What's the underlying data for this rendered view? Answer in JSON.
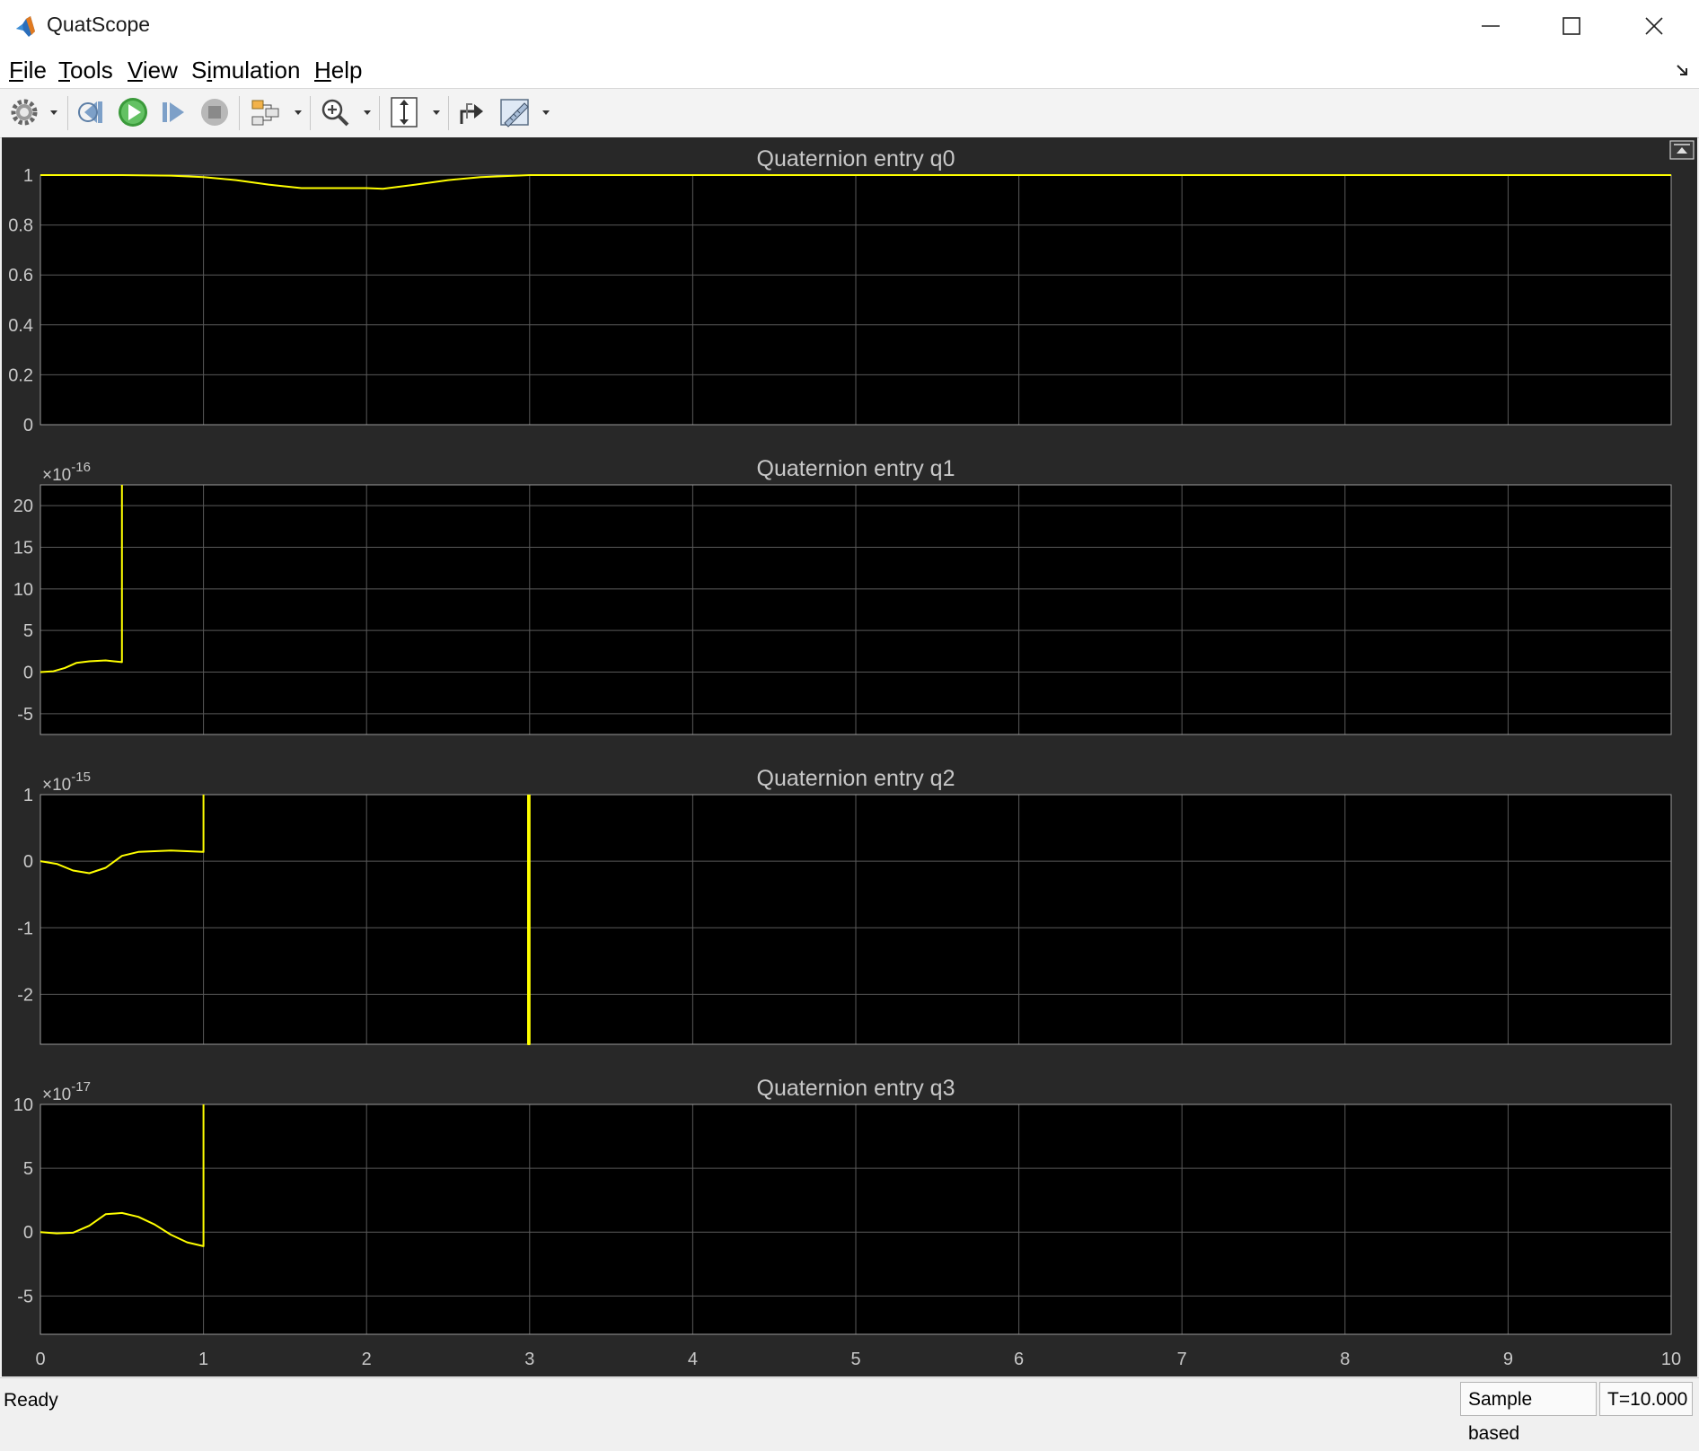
{
  "window": {
    "title": "QuatScope"
  },
  "menu": [
    {
      "pre": "",
      "ul": "F",
      "post": "ile"
    },
    {
      "pre": "",
      "ul": "T",
      "post": "ools"
    },
    {
      "pre": "",
      "ul": "V",
      "post": "iew"
    },
    {
      "pre": "S",
      "ul": "i",
      "post": "mulation"
    },
    {
      "pre": "",
      "ul": "H",
      "post": "elp"
    }
  ],
  "toolbar": {
    "items": [
      "settings-icon",
      "dropdown-arrow-icon",
      "step-back-icon",
      "run-icon",
      "step-forward-icon",
      "stop-icon",
      "highlight-block-icon",
      "dropdown-arrow-icon",
      "zoom-in-icon",
      "dropdown-arrow-icon",
      "autoscale-icon",
      "dropdown-arrow-icon",
      "restore-layout-icon",
      "measurements-icon",
      "dropdown-arrow-icon"
    ]
  },
  "status": {
    "left": "Ready",
    "mode": "Sample based",
    "time": "T=10.000"
  },
  "colors": {
    "plot_bg": "#000000",
    "panel_bg": "#282828",
    "grid": "#5a5a5a",
    "axis_text": "#c8c8c8",
    "line": "#ffff00"
  },
  "chart_data": [
    {
      "type": "line",
      "title": "Quaternion entry q0",
      "exponent_base": "×10",
      "exponent": "",
      "xlim": [
        0,
        10
      ],
      "ylim": [
        0,
        1
      ],
      "xticks": [
        0,
        1,
        2,
        3,
        4,
        5,
        6,
        7,
        8,
        9,
        10
      ],
      "yticks": [
        "1",
        "0.8",
        "0.6",
        "0.4",
        "0.2",
        "0"
      ],
      "ytick_values": [
        1,
        0.8,
        0.6,
        0.4,
        0.2,
        0
      ],
      "grid": true,
      "series": [
        {
          "x": [
            0,
            0.5,
            0.8,
            1.0,
            1.2,
            1.4,
            1.6,
            1.8,
            2.0,
            2.1,
            2.3,
            2.5,
            2.7,
            3.0,
            10
          ],
          "y": [
            1,
            1,
            0.998,
            0.992,
            0.98,
            0.962,
            0.948,
            0.948,
            0.948,
            0.945,
            0.962,
            0.98,
            0.992,
            1,
            1
          ]
        }
      ]
    },
    {
      "type": "line",
      "title": "Quaternion entry q1",
      "exponent_base": "×10",
      "exponent": "-16",
      "xlim": [
        0,
        10
      ],
      "ylim": [
        -7.5,
        22.5
      ],
      "xticks": [
        0,
        1,
        2,
        3,
        4,
        5,
        6,
        7,
        8,
        9,
        10
      ],
      "yticks": [
        "20",
        "15",
        "10",
        "5",
        "0",
        "-5"
      ],
      "ytick_values": [
        20,
        15,
        10,
        5,
        0,
        -5
      ],
      "grid": true,
      "series": [
        {
          "x": [
            0,
            0.08,
            0.15,
            0.22,
            0.3,
            0.4,
            0.5,
            0.5,
            0.5
          ],
          "y": [
            0,
            0.1,
            0.5,
            1.1,
            1.3,
            1.4,
            1.2,
            1.2,
            22.5
          ]
        }
      ]
    },
    {
      "type": "line",
      "title": "Quaternion entry q2",
      "exponent_base": "×10",
      "exponent": "-15",
      "xlim": [
        0,
        10
      ],
      "ylim": [
        -2.75,
        1
      ],
      "xticks": [
        0,
        1,
        2,
        3,
        4,
        5,
        6,
        7,
        8,
        9,
        10
      ],
      "yticks": [
        "1",
        "0",
        "-1",
        "-2"
      ],
      "ytick_values": [
        1,
        0,
        -1,
        -2
      ],
      "grid": true,
      "series": [
        {
          "x": [
            0,
            0.1,
            0.2,
            0.3,
            0.4,
            0.5,
            0.6,
            0.8,
            1.0,
            1.0,
            1.0
          ],
          "y": [
            0,
            -0.04,
            -0.14,
            -0.18,
            -0.1,
            0.08,
            0.14,
            0.16,
            0.14,
            0.14,
            1.0
          ]
        },
        {
          "x": [
            2.99,
            2.99,
            3.0,
            3.0
          ],
          "y": [
            1.0,
            -2.75,
            -2.75,
            1.0
          ]
        }
      ]
    },
    {
      "type": "line",
      "title": "Quaternion entry q3",
      "exponent_base": "×10",
      "exponent": "-17",
      "xlim": [
        0,
        10
      ],
      "ylim": [
        -8,
        10
      ],
      "xticks": [
        0,
        1,
        2,
        3,
        4,
        5,
        6,
        7,
        8,
        9,
        10
      ],
      "xticklabels": [
        "0",
        "1",
        "2",
        "3",
        "4",
        "5",
        "6",
        "7",
        "8",
        "9",
        "10"
      ],
      "yticks": [
        "10",
        "5",
        "0",
        "-5"
      ],
      "ytick_values": [
        10,
        5,
        0,
        -5
      ],
      "grid": true,
      "series": [
        {
          "x": [
            0,
            0.1,
            0.2,
            0.3,
            0.4,
            0.5,
            0.6,
            0.7,
            0.8,
            0.9,
            1.0,
            1.0
          ],
          "y": [
            0,
            -0.1,
            -0.05,
            0.5,
            1.4,
            1.5,
            1.2,
            0.6,
            -0.2,
            -0.8,
            -1.1,
            10
          ]
        }
      ]
    }
  ]
}
